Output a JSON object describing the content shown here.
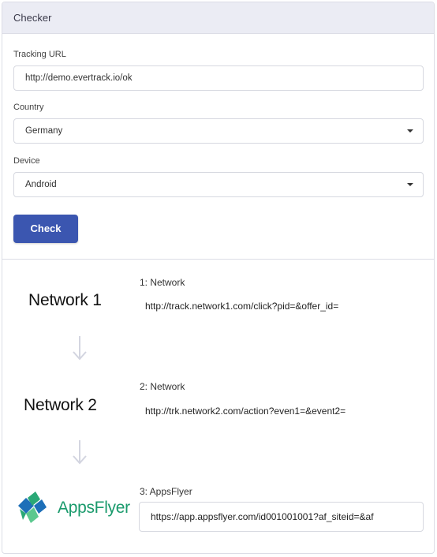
{
  "header": {
    "title": "Checker"
  },
  "form": {
    "tracking_url": {
      "label": "Tracking URL",
      "value": "http://demo.evertrack.io/ok"
    },
    "country": {
      "label": "Country",
      "value": "Germany"
    },
    "device": {
      "label": "Device",
      "value": "Android"
    },
    "check_label": "Check"
  },
  "flow": [
    {
      "logo": "Network 1",
      "title": "1: Network",
      "url": "http://track.network1.com/click?pid=&offer_id="
    },
    {
      "logo": "Network 2",
      "title": "2: Network",
      "url": "http://trk.network2.com/action?even1=&event2="
    },
    {
      "logo": "AppsFlyer",
      "title": "3: AppsFlyer",
      "url": "https://app.appsflyer.com/id001001001?af_siteid=&af"
    }
  ],
  "icons": {
    "arrow": "arrow-down-icon",
    "caret": "caret-down-icon",
    "logo": "appsflyer-logo"
  },
  "colors": {
    "primary": "#3b56b0",
    "header_bg": "#ebecf4",
    "appsflyer_green": "#1a9a6c",
    "appsflyer_blue": "#1d6fb8"
  }
}
